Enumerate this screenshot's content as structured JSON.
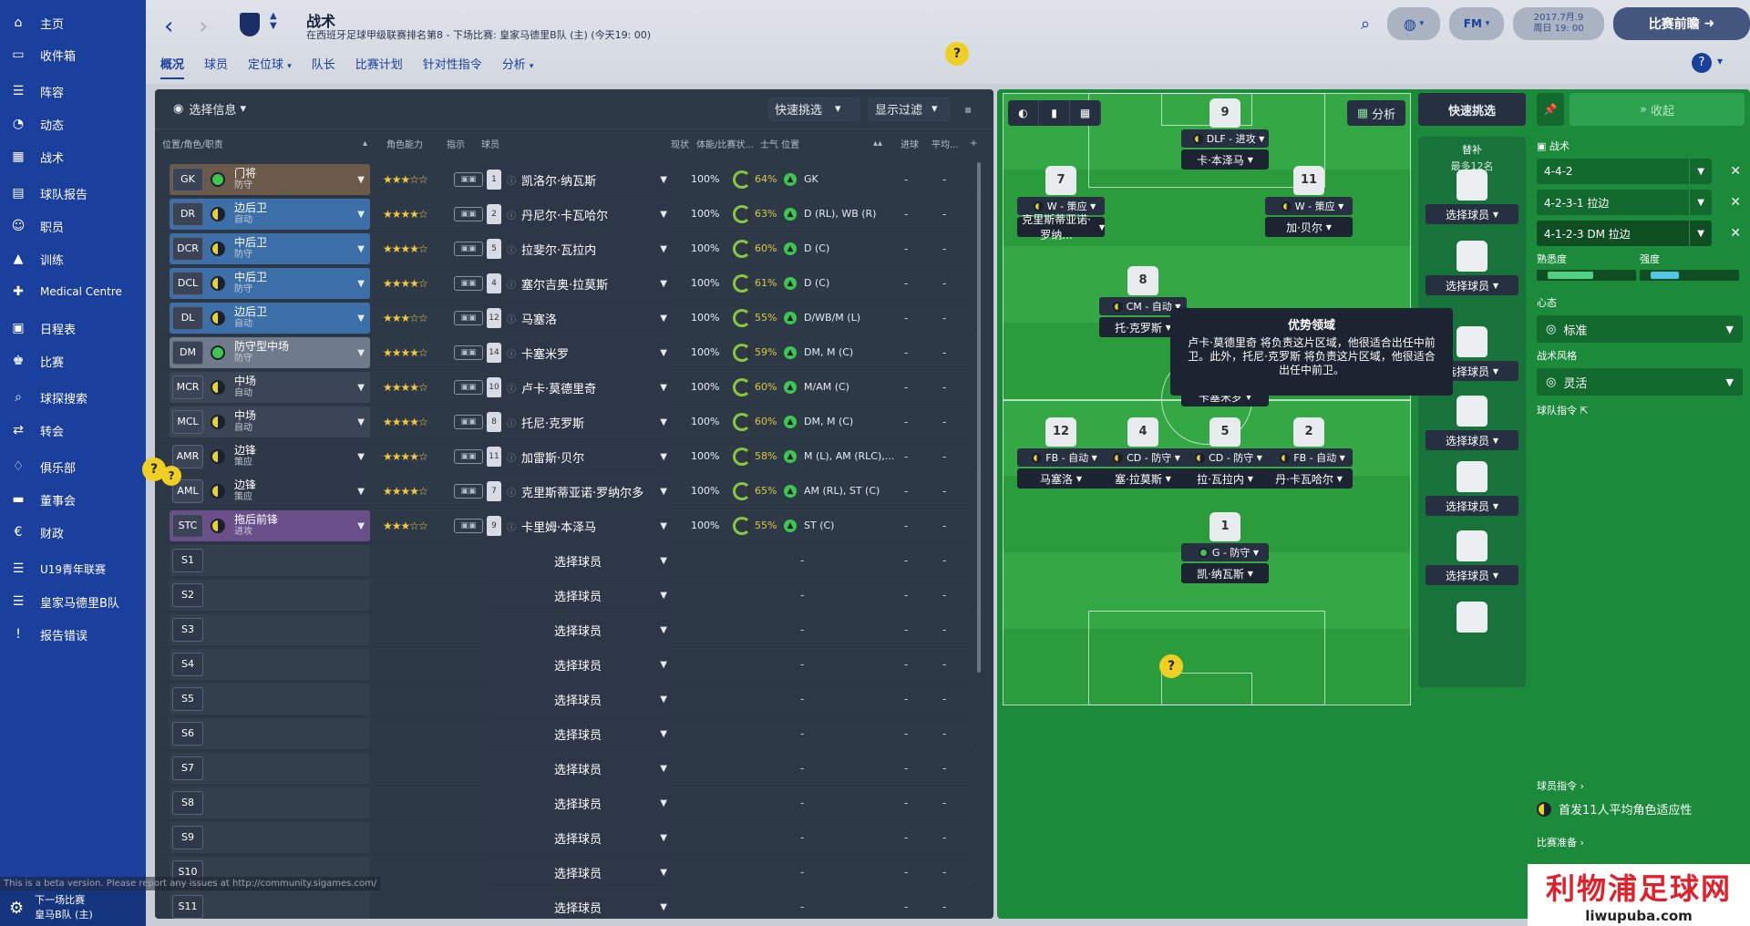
{
  "sidebar": {
    "items": [
      {
        "label": "主页",
        "icon": "home-icon",
        "glyph": "⌂"
      },
      {
        "label": "收件箱",
        "icon": "inbox-icon",
        "glyph": "▭"
      },
      {
        "label": "阵容",
        "icon": "squad-icon",
        "glyph": "☰"
      },
      {
        "label": "动态",
        "icon": "dynamics-icon",
        "glyph": "◔"
      },
      {
        "label": "战术",
        "icon": "tactics-icon",
        "glyph": "▦"
      },
      {
        "label": "球队报告",
        "icon": "report-icon",
        "glyph": "▤"
      },
      {
        "label": "职员",
        "icon": "staff-icon",
        "glyph": "☺"
      },
      {
        "label": "训练",
        "icon": "training-icon",
        "glyph": "▲"
      },
      {
        "label": "Medical Centre",
        "icon": "medical-icon",
        "glyph": "✚"
      },
      {
        "label": "日程表",
        "icon": "calendar-icon",
        "glyph": "▣"
      },
      {
        "label": "比赛",
        "icon": "trophy-icon",
        "glyph": "♚"
      },
      {
        "label": "球探搜索",
        "icon": "search-icon",
        "glyph": "⌕"
      },
      {
        "label": "转会",
        "icon": "transfer-icon",
        "glyph": "⇄"
      },
      {
        "label": "俱乐部",
        "icon": "club-icon",
        "glyph": "♢"
      },
      {
        "label": "董事会",
        "icon": "board-icon",
        "glyph": "▬"
      },
      {
        "label": "财政",
        "icon": "finance-icon",
        "glyph": "€"
      },
      {
        "label": "U19青年联赛",
        "icon": "youth-icon",
        "glyph": "☰"
      },
      {
        "label": "皇家马德里B队",
        "icon": "b-team-icon",
        "glyph": "☰"
      },
      {
        "label": "报告错误",
        "icon": "bug-report-icon",
        "glyph": "!"
      }
    ],
    "footer": {
      "line1": "下一场比赛",
      "line2": "皇马B队 (主)"
    },
    "beta": "This is a beta version. Please report any issues at http://community.sigames.com/"
  },
  "topbar": {
    "title": "战术",
    "subtitle": "在西班牙足球甲级联赛排名第8 - 下场比赛: 皇家马德里B队 (主) (今天19: 00)",
    "tabs": [
      "概况",
      "球员",
      "定位球",
      "队长",
      "比赛计划",
      "针对性指令",
      "分析"
    ],
    "date_line1": "2017.7月.9",
    "date_line2": "周日 19: 00",
    "fm_label": "FM",
    "match_preview": "比赛前瞻"
  },
  "left": {
    "info_label": "选择信息",
    "quick_pick": "快速挑选",
    "display_filter": "显示过滤",
    "columns": {
      "pos": "位置/角色/职责",
      "ability": "角色能力",
      "instr": "指示",
      "player": "球员",
      "status": "现状",
      "cond": "体能/比赛状...",
      "morale": "士气 位置",
      "goals": "进球",
      "avg": "平均..."
    },
    "starters": [
      {
        "code": "GK",
        "dot": "g",
        "role": "门将",
        "duty": "防守",
        "stars": "★★★☆☆",
        "num": "1",
        "name": "凯洛尔·纳瓦斯",
        "cond": "100%",
        "morale": "64%",
        "pos": "GK",
        "bg": "#6b5a4a"
      },
      {
        "code": "DR",
        "dot": "y",
        "role": "边后卫",
        "duty": "自动",
        "stars": "★★★★☆",
        "num": "2",
        "name": "丹尼尔·卡瓦哈尔",
        "cond": "100%",
        "morale": "63%",
        "pos": "D (RL), WB (R)",
        "bg": "#3c6fa8"
      },
      {
        "code": "DCR",
        "dot": "y",
        "role": "中后卫",
        "duty": "防守",
        "stars": "★★★★☆",
        "num": "5",
        "name": "拉斐尔·瓦拉内",
        "cond": "100%",
        "morale": "60%",
        "pos": "D (C)",
        "bg": "#3c6fa8"
      },
      {
        "code": "DCL",
        "dot": "y",
        "role": "中后卫",
        "duty": "防守",
        "stars": "★★★★☆",
        "num": "4",
        "name": "塞尔吉奥·拉莫斯",
        "cond": "100%",
        "morale": "61%",
        "pos": "D (C)",
        "bg": "#3c6fa8"
      },
      {
        "code": "DL",
        "dot": "y",
        "role": "边后卫",
        "duty": "自动",
        "stars": "★★★☆☆",
        "num": "12",
        "name": "马塞洛",
        "cond": "100%",
        "morale": "55%",
        "pos": "D/WB/M (L)",
        "bg": "#3c6fa8"
      },
      {
        "code": "DM",
        "dot": "g",
        "role": "防守型中场",
        "duty": "防守",
        "stars": "★★★★☆",
        "num": "14",
        "name": "卡塞米罗",
        "cond": "100%",
        "morale": "59%",
        "pos": "DM, M (C)",
        "bg": "#6f7a8a"
      },
      {
        "code": "MCR",
        "dot": "y",
        "role": "中场",
        "duty": "自动",
        "stars": "★★★★☆",
        "num": "10",
        "name": "卢卡·莫德里奇",
        "cond": "100%",
        "morale": "60%",
        "pos": "M/AM (C)",
        "bg": "#3b4556"
      },
      {
        "code": "MCL",
        "dot": "y",
        "role": "中场",
        "duty": "自动",
        "stars": "★★★★☆",
        "num": "8",
        "name": "托尼·克罗斯",
        "cond": "100%",
        "morale": "60%",
        "pos": "DM, M (C)",
        "bg": "#3b4556"
      },
      {
        "code": "AMR",
        "dot": "y",
        "role": "边锋",
        "duty": "策应",
        "stars": "★★★★☆",
        "num": "11",
        "name": "加雷斯·贝尔",
        "cond": "100%",
        "morale": "58%",
        "pos": "M (L), AM (RLC),...",
        "bg": "#2f3848"
      },
      {
        "code": "AML",
        "dot": "y",
        "role": "边锋",
        "duty": "策应",
        "stars": "★★★★☆",
        "num": "7",
        "name": "克里斯蒂亚诺·罗纳尔多",
        "cond": "100%",
        "morale": "65%",
        "pos": "AM (RL), ST (C)",
        "bg": "#2f3848"
      },
      {
        "code": "STC",
        "dot": "y",
        "role": "拖后前锋",
        "duty": "进攻",
        "stars": "★★★☆☆",
        "num": "9",
        "name": "卡里姆·本泽马",
        "cond": "100%",
        "morale": "55%",
        "pos": "ST (C)",
        "bg": "#6a4e8a"
      }
    ],
    "subs": [
      "S1",
      "S2",
      "S3",
      "S4",
      "S5",
      "S6",
      "S7",
      "S8",
      "S9",
      "S10",
      "S11"
    ],
    "select_player": "选择球员",
    "dash": "-"
  },
  "pitch": {
    "analysis": "分析",
    "players": [
      {
        "num": "9",
        "role": "DLF - 进攻",
        "name": "卡·本泽马",
        "dot": "y",
        "area": "st"
      },
      {
        "num": "7",
        "role": "W - 策应",
        "name": "克里斯蒂亚诺·罗纳...",
        "dot": "y",
        "area": "aml"
      },
      {
        "num": "11",
        "role": "W - 策应",
        "name": "加·贝尔",
        "dot": "y",
        "area": "amr"
      },
      {
        "num": "8",
        "role": "CM - 自动",
        "name": "托·克罗斯",
        "dot": "y",
        "area": "mcl"
      },
      {
        "num": "14",
        "role": "DM - 防守",
        "name": "卡塞米罗",
        "dot": "g",
        "area": "dm"
      },
      {
        "num": "12",
        "role": "FB - 自动",
        "name": "马塞洛",
        "dot": "y",
        "area": "dl"
      },
      {
        "num": "4",
        "role": "CD - 防守",
        "name": "塞·拉莫斯",
        "dot": "y",
        "area": "dcl"
      },
      {
        "num": "5",
        "role": "CD - 防守",
        "name": "拉·瓦拉内",
        "dot": "y",
        "area": "dcr"
      },
      {
        "num": "2",
        "role": "FB - 自动",
        "name": "丹·卡瓦哈尔",
        "dot": "y",
        "area": "dr"
      },
      {
        "num": "1",
        "role": "G - 防守",
        "name": "凯·纳瓦斯",
        "dot": "g",
        "area": "gk"
      }
    ],
    "tooltip": {
      "title": "优势领域",
      "body": "卢卡·莫德里奇 将负责这片区域，他很适合出任中前卫。此外，托尼·克罗斯 将负责这片区域，他很适合出任中前卫。"
    },
    "quick_pick": "快速挑选",
    "subs_title": "替补",
    "subs_max": "最多12名",
    "select_player": "选择球员",
    "collapse": "收起",
    "tactics_label": "战术",
    "formations": [
      "4-4-2",
      "4-2-3-1 拉边",
      "4-1-2-3 DM 拉边"
    ],
    "familiarity": "熟悉度",
    "intensity": "强度",
    "familiarity_value": 0.58,
    "intensity_value": 0.36,
    "mentality_label": "心态",
    "mentality": "标准",
    "style_label": "战术风格",
    "style": "灵活",
    "team_instr": "球队指令",
    "player_instr": "球员指令 ›",
    "avg_fit": "首发11人平均角色适应性",
    "match_prep": "比赛准备 ›"
  },
  "watermark": {
    "a": "利物浦足球网",
    "b": "liwupuba.com"
  },
  "colors": {
    "sidebar": "#1b3f9c",
    "pitch": "#1b8a3a",
    "panel": "#263040",
    "accent": "#f0cf25"
  }
}
